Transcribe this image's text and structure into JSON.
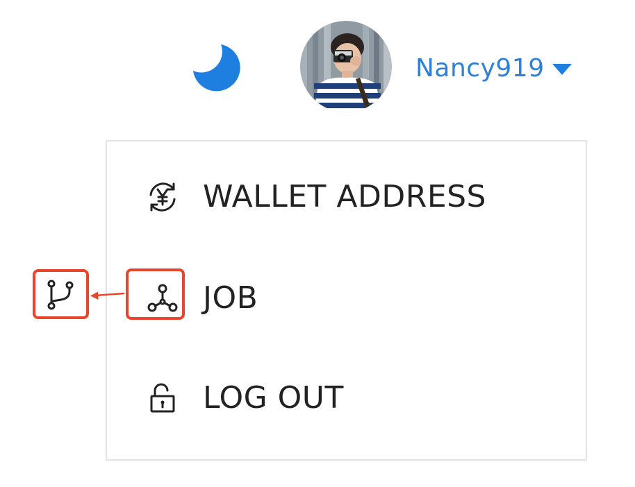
{
  "header": {
    "theme_toggle_icon": "moon-icon",
    "avatar_icon": "user-avatar-photo",
    "user_name": "Nancy919",
    "user_menu_icon": "caret-down-icon",
    "accent_color": "#2f80d8"
  },
  "dropdown": {
    "items": [
      {
        "label": "WALLET ADDRESS",
        "icon": "yen-exchange-icon"
      },
      {
        "label": "JOB",
        "icon": "nodes-network-icon"
      },
      {
        "label": "LOG OUT",
        "icon": "unlock-icon"
      }
    ]
  },
  "annotation": {
    "highlight_color": "#e8452c",
    "replacement_icon": "git-branch-icon",
    "arrow_icon": "arrow-left-icon"
  }
}
